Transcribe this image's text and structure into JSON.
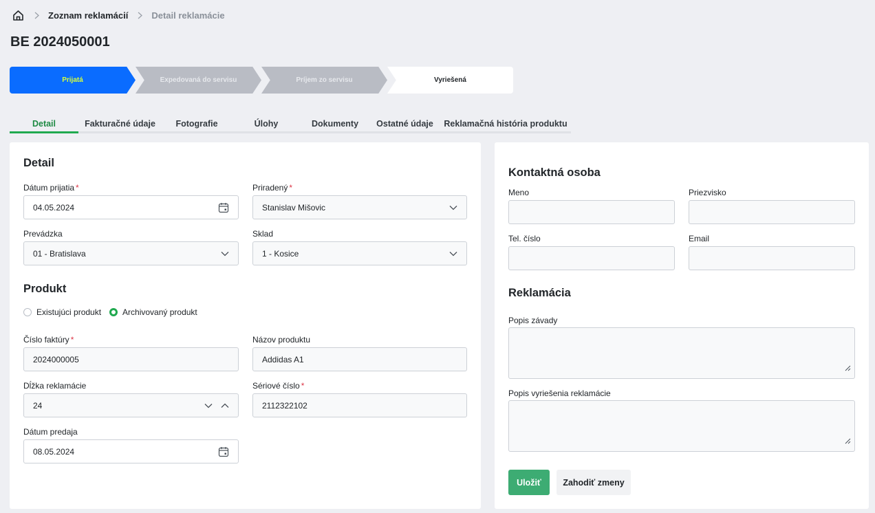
{
  "breadcrumb": {
    "home_icon": "home-icon",
    "items": [
      "Zoznam reklamácií",
      "Detail reklamácie"
    ]
  },
  "page_title": "BE 2024050001",
  "stepper": {
    "steps": [
      "Prijatá",
      "Expedovaná do servisu",
      "Príjem zo servisu",
      "Vyriešená"
    ],
    "active_color": "#0a6cff",
    "active_text_color": "#d6ff3a"
  },
  "tabs": [
    "Detail",
    "Fakturačné údaje",
    "Fotografie",
    "Úlohy",
    "Dokumenty",
    "Ostatné údaje",
    "Reklamačná história produktu"
  ],
  "detail": {
    "title": "Detail",
    "date_received": {
      "label": "Dátum prijatia",
      "value": "04.05.2024"
    },
    "assigned": {
      "label": "Priradený",
      "value": "Stanislav Mišovic"
    },
    "branch": {
      "label": "Prevádzka",
      "value": "01 - Bratislava"
    },
    "warehouse": {
      "label": "Sklad",
      "value": "1 - Kosice"
    }
  },
  "product": {
    "title": "Produkt",
    "radio_existing": "Existujúci produkt",
    "radio_archived": "Archivovaný produkt",
    "invoice_number": {
      "label": "Číslo faktúry",
      "value": "2024000005"
    },
    "product_name": {
      "label": "Názov produktu",
      "value": "Addidas A1"
    },
    "claim_length": {
      "label": "Dĺžka reklamácie",
      "value": "24"
    },
    "serial_number": {
      "label": "Sériové číslo",
      "value": "2112322102"
    },
    "sale_date": {
      "label": "Dátum predaja",
      "value": "08.05.2024"
    }
  },
  "contact": {
    "title": "Kontaktná osoba",
    "first_name_label": "Meno",
    "last_name_label": "Priezvisko",
    "phone_label": "Tel. číslo",
    "email_label": "Email"
  },
  "claim": {
    "title": "Reklamácia",
    "defect_label": "Popis závady",
    "resolution_label": "Popis vyriešenia reklamácie"
  },
  "actions": {
    "save": "Uložiť",
    "discard": "Zahodiť zmeny",
    "save_color": "#3dac73"
  },
  "colors": {
    "accent_green": "#20a94f",
    "required": "#dc3545"
  }
}
